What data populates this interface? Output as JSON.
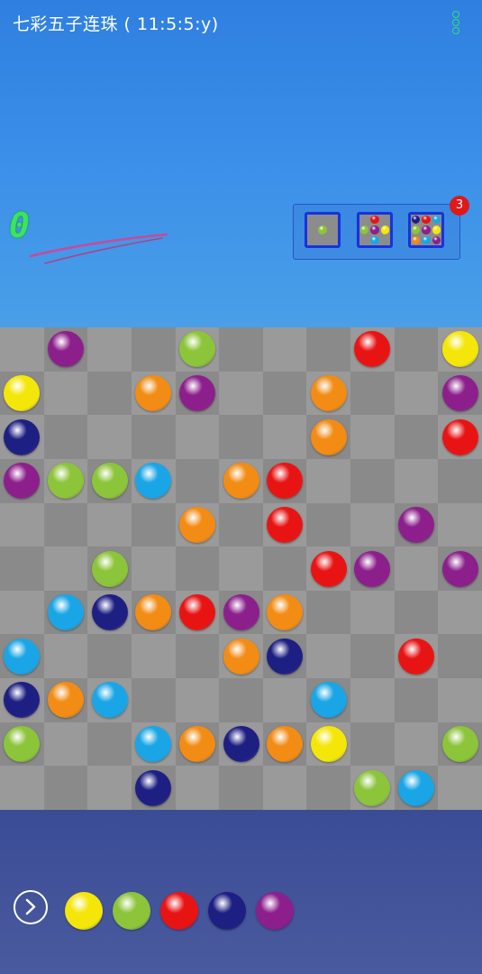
{
  "header": {
    "title": "七彩五子连珠 ( 11:5:5:y)",
    "menu_icon": "vertical-ellipsis-icon"
  },
  "score": {
    "value": "0",
    "color": "#39e65a"
  },
  "modes": {
    "items": [
      {
        "name": "single-ball-mode",
        "balls": [
          "",
          "",
          "",
          "",
          "green",
          "",
          "",
          "",
          ""
        ]
      },
      {
        "name": "five-ball-mode",
        "balls": [
          "",
          "red",
          "",
          "green",
          "purple",
          "yellow",
          "",
          "blue",
          ""
        ]
      },
      {
        "name": "nine-ball-mode",
        "balls": [
          "navy",
          "red",
          "blue",
          "green",
          "purple",
          "yellow",
          "orange",
          "blue",
          "purple"
        ]
      }
    ],
    "badge": "3"
  },
  "colors": {
    "red": "#e81414",
    "yellow": "#f5e60a",
    "green": "#8cc43a",
    "orange": "#f28c14",
    "purple": "#8c1f8c",
    "navy": "#1e1f82",
    "blue": "#1aa6e6",
    "board_light": "#9a9a9a",
    "board_dark": "#8a8a8a"
  },
  "board": {
    "size": 11,
    "rows": [
      [
        null,
        "purple",
        null,
        null,
        "green",
        null,
        null,
        null,
        "red",
        null,
        "yellow"
      ],
      [
        "yellow",
        null,
        null,
        "orange",
        "purple",
        null,
        null,
        "orange",
        null,
        null,
        "purple"
      ],
      [
        "navy",
        null,
        null,
        null,
        null,
        null,
        null,
        "orange",
        null,
        null,
        "red"
      ],
      [
        "purple",
        "green",
        "green",
        "blue",
        null,
        "orange",
        "red",
        null,
        null,
        null,
        null
      ],
      [
        null,
        null,
        null,
        null,
        "orange",
        null,
        "red",
        null,
        null,
        "purple",
        null
      ],
      [
        null,
        null,
        "green",
        null,
        null,
        null,
        null,
        "red",
        "purple",
        null,
        "purple"
      ],
      [
        null,
        "blue",
        "navy",
        "orange",
        "red",
        "purple",
        "orange",
        null,
        null,
        null,
        null
      ],
      [
        "blue",
        null,
        null,
        null,
        null,
        "orange",
        "navy",
        null,
        null,
        "red",
        null
      ],
      [
        "navy",
        "orange",
        "blue",
        null,
        null,
        null,
        null,
        "blue",
        null,
        null,
        null
      ],
      [
        "green",
        null,
        null,
        "blue",
        "orange",
        "navy",
        "orange",
        "yellow",
        null,
        null,
        "green"
      ],
      [
        null,
        null,
        null,
        "navy",
        null,
        null,
        null,
        null,
        "green",
        "blue",
        null
      ]
    ]
  },
  "next": {
    "button_icon": "chevron-right-circle-icon",
    "balls": [
      "yellow",
      "green",
      "red",
      "navy",
      "purple"
    ]
  }
}
